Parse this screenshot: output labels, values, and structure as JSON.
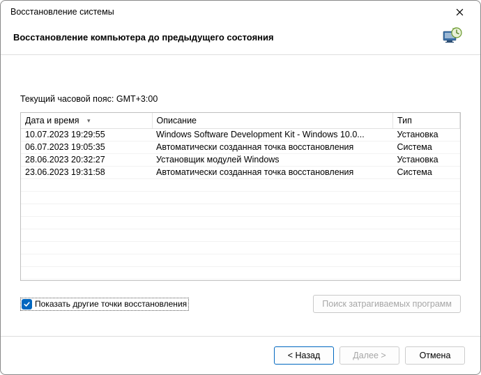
{
  "window": {
    "title": "Восстановление системы"
  },
  "header": {
    "heading": "Восстановление компьютера до предыдущего состояния"
  },
  "tz": {
    "label": "Текущий часовой пояс: GMT+3:00"
  },
  "table": {
    "columns": {
      "datetime": "Дата и время",
      "description": "Описание",
      "type": "Тип"
    },
    "rows": [
      {
        "datetime": "10.07.2023 19:29:55",
        "description": "Windows Software Development Kit - Windows 10.0...",
        "type": "Установка"
      },
      {
        "datetime": "06.07.2023 19:05:35",
        "description": "Автоматически созданная точка восстановления",
        "type": "Система"
      },
      {
        "datetime": "28.06.2023 20:32:27",
        "description": "Установщик модулей Windows",
        "type": "Установка"
      },
      {
        "datetime": "23.06.2023 19:31:58",
        "description": "Автоматически созданная точка восстановления",
        "type": "Система"
      }
    ]
  },
  "options": {
    "show_more": "Показать другие точки восстановления",
    "affected_programs": "Поиск затрагиваемых программ"
  },
  "footer": {
    "back": "< Назад",
    "next": "Далее >",
    "cancel": "Отмена"
  }
}
